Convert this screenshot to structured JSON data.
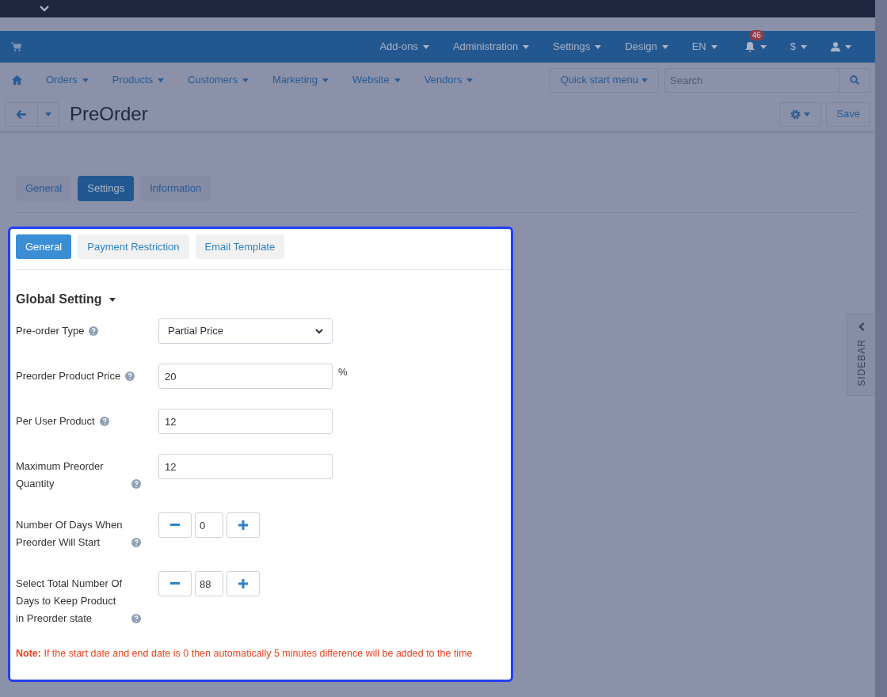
{
  "header_menu": [
    {
      "label": "Add-ons"
    },
    {
      "label": "Administration"
    },
    {
      "label": "Settings"
    },
    {
      "label": "Design"
    },
    {
      "label": "EN"
    }
  ],
  "notifications": {
    "count": "46"
  },
  "currency": {
    "label": "$"
  },
  "main_nav": [
    {
      "label": "Orders"
    },
    {
      "label": "Products"
    },
    {
      "label": "Customers"
    },
    {
      "label": "Marketing"
    },
    {
      "label": "Website"
    },
    {
      "label": "Vendors"
    }
  ],
  "quick_start": {
    "label": "Quick start menu"
  },
  "search": {
    "placeholder": "Search"
  },
  "page": {
    "title": "PreOrder",
    "save": "Save"
  },
  "tabs": [
    {
      "label": "General",
      "selected": false
    },
    {
      "label": "Settings",
      "selected": true
    },
    {
      "label": "Information",
      "selected": false
    }
  ],
  "subtabs": [
    {
      "label": "General",
      "selected": true
    },
    {
      "label": "Payment Restriction",
      "selected": false
    },
    {
      "label": "Email Template",
      "selected": false
    }
  ],
  "section": {
    "title": "Global Setting"
  },
  "fields": [
    {
      "kind": "select",
      "label": "Pre-order Type",
      "value": "Partial Price"
    },
    {
      "kind": "text",
      "label": "Preorder Product Price",
      "value": "20",
      "suffix": "%"
    },
    {
      "kind": "text",
      "label": "Per User Product",
      "value": "12"
    },
    {
      "kind": "text",
      "label": "Maximum Preorder Quantity",
      "value": "12"
    },
    {
      "kind": "stepper",
      "label": "Number Of Days When Preorder Will Start",
      "value": "0"
    },
    {
      "kind": "stepper",
      "label": "Select Total Number Of Days to Keep Product in Preorder state",
      "value": "88"
    }
  ],
  "note": "**Note:** If the start date and end date is 0 then automatically 5 minutes difference will be added to the time",
  "sidebar": {
    "label": "SIDEBAR"
  }
}
